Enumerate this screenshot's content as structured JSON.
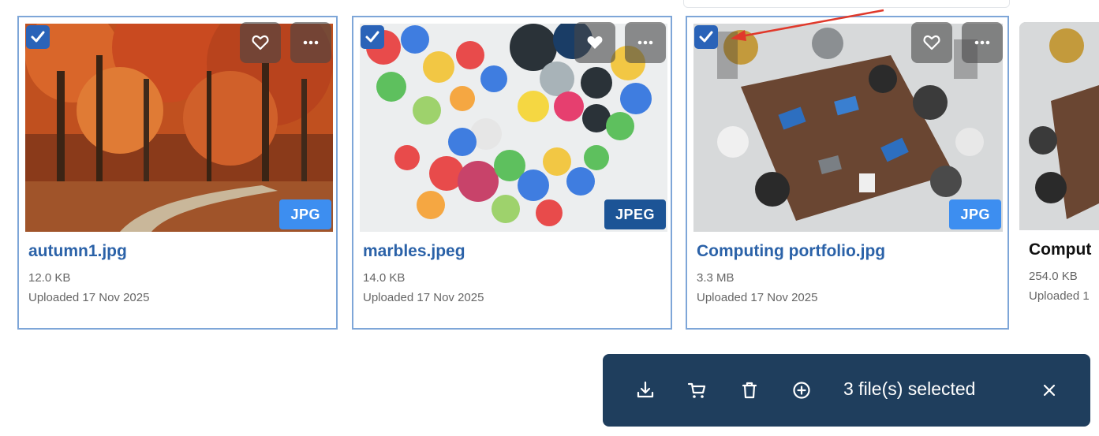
{
  "cards": [
    {
      "name": "autumn1.jpg",
      "size": "12.0 KB",
      "uploaded": "Uploaded 17 Nov 2025",
      "badge": "JPG",
      "selected": true
    },
    {
      "name": "marbles.jpeg",
      "size": "14.0 KB",
      "uploaded": "Uploaded 17 Nov 2025",
      "badge": "JPEG",
      "selected": true
    },
    {
      "name": "Computing portfolio.jpg",
      "size": "3.3 MB",
      "uploaded": "Uploaded 17 Nov 2025",
      "badge": "JPG",
      "selected": true
    },
    {
      "name": "Comput",
      "size": "254.0 KB",
      "uploaded": "Uploaded 1"
    }
  ],
  "toolbar": {
    "selected_text": "3 file(s) selected",
    "icons": [
      "download-icon",
      "cart-icon",
      "trash-icon",
      "add-circle-icon",
      "close-icon"
    ]
  },
  "colors": {
    "accent": "#2b62a8",
    "card_border": "#7ea6d8",
    "jpg_badge": "#3d8ef0",
    "jpeg_badge": "#1c5496",
    "toolbar_bg": "#1f3e5d",
    "annotation_arrow": "#e0392b"
  }
}
